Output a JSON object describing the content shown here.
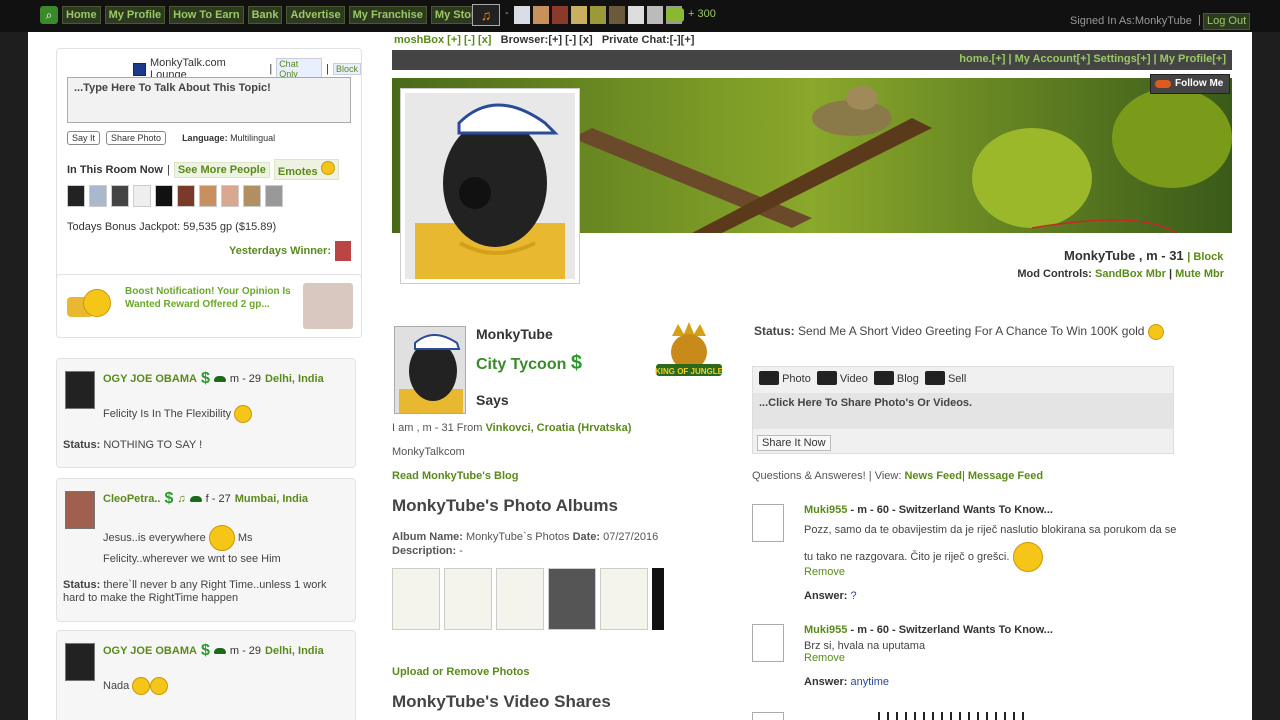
{
  "topbar": {
    "nav": [
      "Home",
      "My Profile",
      "How To Earn",
      "Bank",
      "Advertise",
      "My Franchise",
      "My Store"
    ],
    "dash": "-",
    "points": "+ 300",
    "signed_in": "Signed In As:MonkyTube",
    "sep": "|",
    "logout": "Log Out"
  },
  "lounge": {
    "title": "MonkyTalk.com Lounge",
    "sep": "|",
    "chat_only": "Chat Only",
    "block": "Block",
    "placeholder": "...Type Here To Talk About This Topic!",
    "say_it": "Say It",
    "share_photo": "Share Photo",
    "language_label": "Language:",
    "language": "Multilingual",
    "in_room": "In This Room Now",
    "see_more": "See More People",
    "emotes": "Emotes",
    "jackpot": "Todays Bonus Jackpot: 59,535 gp ($15.89)",
    "yesterday": "Yesterdays Winner:"
  },
  "boost": {
    "text": "Boost Notification! Your Opinion Is Wanted Reward Offered 2 gp..."
  },
  "feed": [
    {
      "name": "OGY JOE OBAMA",
      "meta": "m - 29",
      "location": "Delhi, India",
      "msg1": "Felicity Is In The Flexibility",
      "msg2": "",
      "status_label": "Status:",
      "status": "NOTHING TO SAY !"
    },
    {
      "name": "CleoPetra..",
      "meta": "f - 27",
      "location": "Mumbai, India",
      "msg1": "Jesus..is everywhere",
      "msg1b": "Ms",
      "msg2": "Felicity..wherever we wnt to see Him",
      "status_label": "Status:",
      "status": "there`ll never b any Right Time..unless 1 work hard to make the RightTime happen"
    },
    {
      "name": "OGY JOE OBAMA",
      "meta": "m - 29",
      "location": "Delhi, India",
      "msg1": "Nada"
    }
  ],
  "center_top": {
    "moshbox": "moshBox [+] [-] [x]",
    "browser": "Browser:[+] [-] [x]",
    "private": "Private Chat:[-][+]"
  },
  "navbar": {
    "links": "home.[+] | My Account[+] Settings[+] | My Profile[+]"
  },
  "follow": "Follow Me",
  "profile": {
    "name_line": "MonkyTube , m - 31",
    "block": "| Block",
    "mod_label": "Mod Controls:",
    "sandbox": "SandBox Mbr",
    "mute": "Mute Mbr",
    "pipe": "|",
    "username": "MonkyTube",
    "title": "City Tycoon",
    "says": "Says",
    "loc_prefix": "I am , m - 31 From",
    "location": "Vinkovci, Croatia (Hrvatska)",
    "site": "MonkyTalkcom",
    "blog_link": "Read MonkyTube's Blog",
    "albums_heading": "MonkyTube's Photo Albums",
    "album_name_label": "Album Name:",
    "album_name": "MonkyTube`s Photos",
    "date_label": "Date:",
    "date": "07/27/2016",
    "desc_label": "Description:",
    "desc": "-",
    "upload_link": "Upload or Remove Photos",
    "videos_heading": "MonkyTube's Video Shares",
    "crest_text": "KING OF JUNGLE"
  },
  "status": {
    "label": "Status:",
    "text": "Send Me A Short Video Greeting For A Chance To Win 100K gold"
  },
  "share": {
    "tabs": [
      "Photo",
      "Video",
      "Blog",
      "Sell"
    ],
    "placeholder": "...Click Here To Share Photo's Or Videos.",
    "button": "Share It Now"
  },
  "qa": {
    "header": "Questions & Answeres! | View:",
    "news": "News Feed",
    "sep": "|",
    "message": "Message Feed",
    "items": [
      {
        "who": "Muki955",
        "rest": " - m - 60 - Switzerland Wants To Know...",
        "msg": "Pozz, samo da te obavijestim da je riječ naslutio blokirana sa porukom da se tu tako ne razgovara. Čito je riječ o grešci.",
        "remove": "Remove",
        "answer_label": "Answer:",
        "answer": "?"
      },
      {
        "who": "Muki955",
        "rest": " - m - 60 - Switzerland Wants To Know...",
        "msg": "Brz si, hvala na uputama",
        "remove": "Remove",
        "answer_label": "Answer:",
        "answer": "anytime"
      }
    ]
  }
}
